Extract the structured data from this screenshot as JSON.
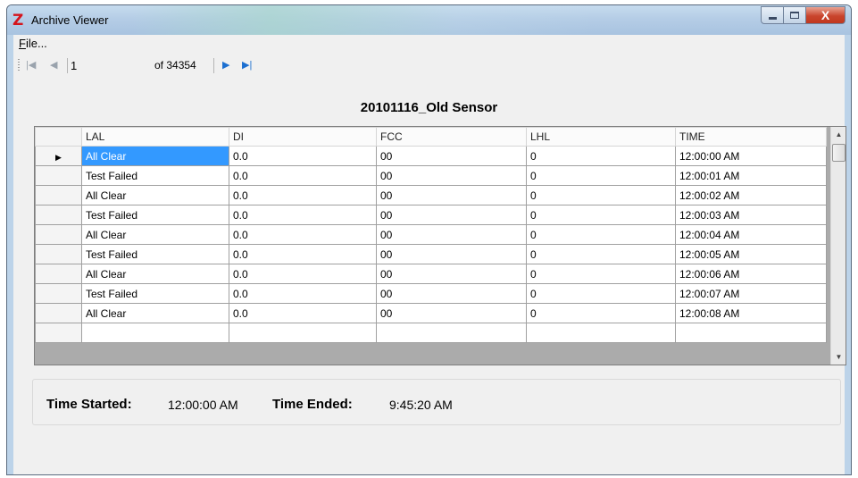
{
  "window": {
    "title": "Archive Viewer",
    "app_icon": "Z",
    "controls": {
      "minimize": "minimize-icon",
      "maximize": "maximize-icon",
      "close": "X"
    }
  },
  "menu": {
    "file_label": "File..."
  },
  "navigator": {
    "position": "1",
    "total_label": "of 34354",
    "icons": [
      "move-first-icon",
      "move-previous-icon",
      "move-next-icon",
      "move-last-icon"
    ]
  },
  "grid": {
    "title": "20101116_Old Sensor",
    "columns": [
      "LAL",
      "DI",
      "FCC",
      "LHL",
      "TIME"
    ],
    "rows": [
      [
        "All Clear",
        "0.0",
        "00",
        "0",
        "12:00:00 AM"
      ],
      [
        "Test Failed",
        "0.0",
        "00",
        "0",
        "12:00:01 AM"
      ],
      [
        "All Clear",
        "0.0",
        "00",
        "0",
        "12:00:02 AM"
      ],
      [
        "Test Failed",
        "0.0",
        "00",
        "0",
        "12:00:03 AM"
      ],
      [
        "All Clear",
        "0.0",
        "00",
        "0",
        "12:00:04 AM"
      ],
      [
        "Test Failed",
        "0.0",
        "00",
        "0",
        "12:00:05 AM"
      ],
      [
        "All Clear",
        "0.0",
        "00",
        "0",
        "12:00:06 AM"
      ],
      [
        "Test Failed",
        "0.0",
        "00",
        "0",
        "12:00:07 AM"
      ],
      [
        "All Clear",
        "0.0",
        "00",
        "0",
        "12:00:08 AM"
      ]
    ],
    "current_row_marker": "▶",
    "selection_color": "#3399ff"
  },
  "summary": {
    "started_label": "Time Started:",
    "started_value": "12:00:00 AM",
    "ended_label": "Time Ended:",
    "ended_value": "9:45:20 AM"
  }
}
